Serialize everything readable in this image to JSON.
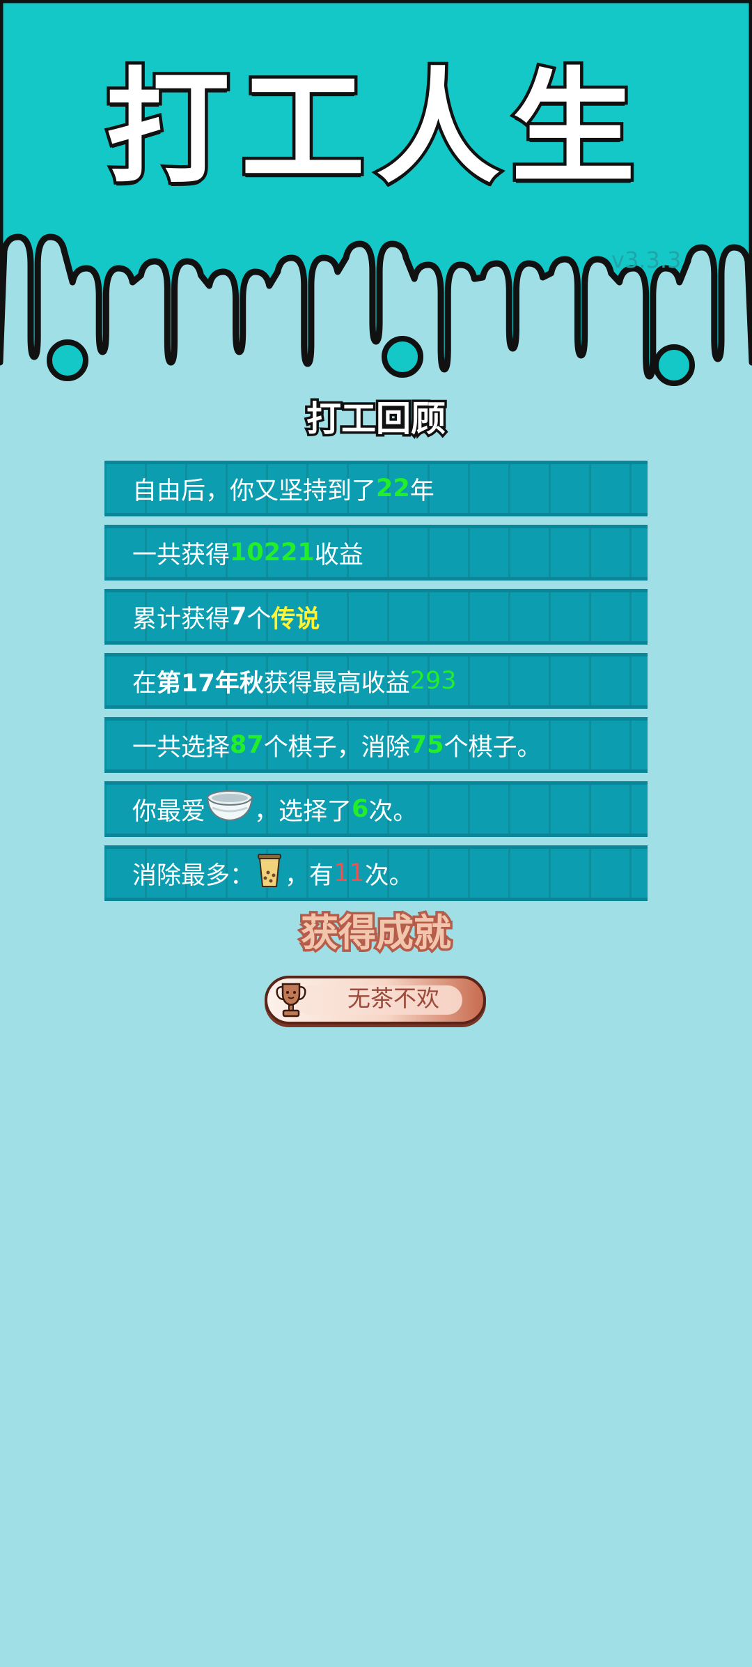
{
  "header": {
    "game_title": "打工人生",
    "version": "v3.3.3"
  },
  "review": {
    "title": "打工回顾",
    "rows": [
      {
        "parts": [
          "自由后，你又坚持到了",
          "22",
          "年"
        ]
      },
      {
        "parts": [
          "一共获得",
          "10221",
          "收益"
        ]
      },
      {
        "parts": [
          "累计获得",
          "7",
          "个",
          "传说"
        ]
      },
      {
        "parts": [
          "在 ",
          "第17年秋",
          " 获得最高收益",
          "293"
        ]
      },
      {
        "parts": [
          "一共选择",
          "87",
          "个棋子，消除",
          "75",
          "个棋子。"
        ]
      },
      {
        "parts": [
          "你最爱",
          "，选择了",
          "6",
          "次。"
        ],
        "icon": "bowl-icon"
      },
      {
        "parts": [
          "消除最多：",
          "，有",
          "11",
          "次。"
        ],
        "icon": "bubble-tea-icon"
      }
    ]
  },
  "achievements": {
    "title": "获得成就",
    "items": [
      {
        "label": "无茶不欢",
        "icon": "trophy-icon"
      }
    ]
  },
  "colors": {
    "header_bg": "#15c8c8",
    "page_bg": "#a0dfe5",
    "row_bg": "#0c9eb0",
    "highlight_green": "#22ee2a",
    "highlight_yellow": "#fff233",
    "highlight_red": "#ff4a4a"
  }
}
